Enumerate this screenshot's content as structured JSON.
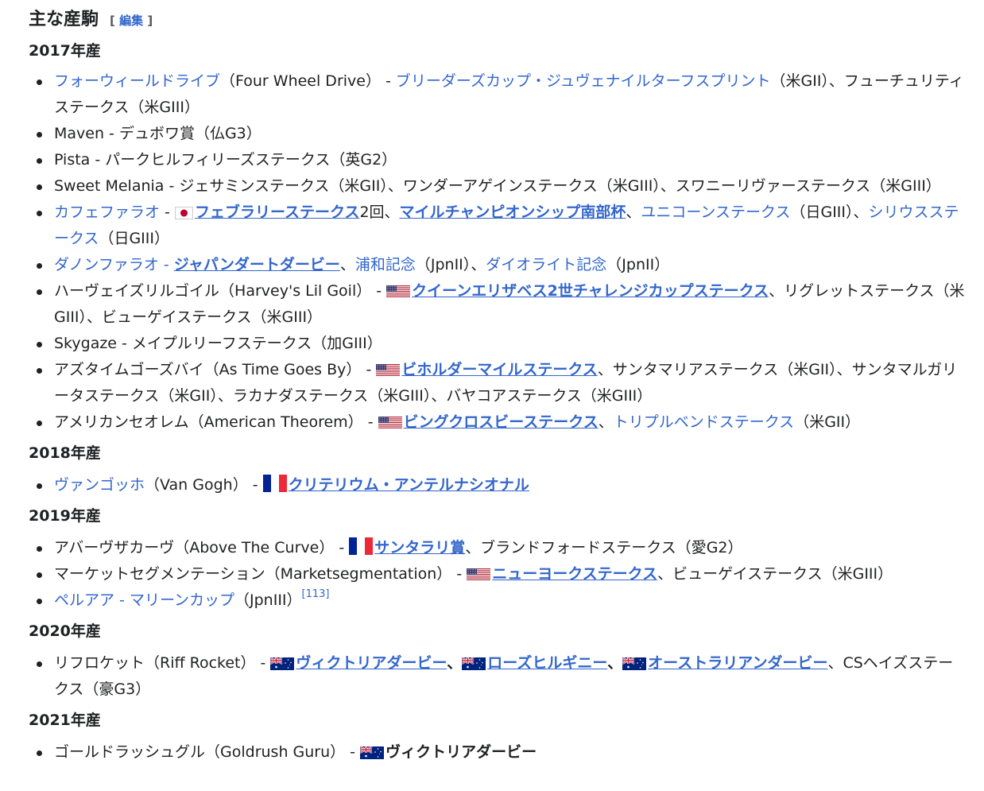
{
  "section": {
    "title": "主な産駒",
    "edit_open": "[ ",
    "edit_label": "編集",
    "edit_close": " ]"
  },
  "years": {
    "y2017": "2017年産",
    "y2018": "2018年産",
    "y2019": "2019年産",
    "y2020": "2020年産",
    "y2021": "2021年産"
  },
  "flags": {
    "jp": "japan-flag-icon",
    "us": "usa-flag-icon",
    "fr": "france-flag-icon",
    "au": "australia-flag-icon"
  },
  "colors": {
    "link": "#3366cc",
    "text": "#202122"
  },
  "items": {
    "i1": {
      "name": "フォーウィールドライブ",
      "orig": "（Four Wheel Drive）",
      "sep": " - ",
      "r1": "ブリーダーズカップ・ジュヴェナイルターフスプリント",
      "rest": "（米GII）、フューチュリティステークス（米GIII）"
    },
    "i2": {
      "text": "Maven - デュボワ賞（仏G3）"
    },
    "i3": {
      "text": "Pista - パークヒルフィリーズステークス（英G2）"
    },
    "i4": {
      "text": "Sweet Melania - ジェサミンステークス（米GII）、ワンダーアゲインステークス（米GIII）、スワニーリヴァーステークス（米GIII）"
    },
    "i5": {
      "name": "カフェファラオ",
      "sep": " - ",
      "r1": "フェブラリーステークス",
      "t1": "2回、",
      "r2": "マイルチャンピオンシップ南部杯",
      "t2": "、",
      "r3": "ユニコーンステークス",
      "t3": "（日GIII）、",
      "r4": "シリウスステークス",
      "t4": "（日GIII）"
    },
    "i6": {
      "name": "ダノンファラオ",
      "sep": " - ",
      "r1": "ジャパンダートダービー",
      "t1": "、",
      "r2": "浦和記念",
      "t2": "（JpnII）、",
      "r3": "ダイオライト記念",
      "t3": "（JpnII）"
    },
    "i7": {
      "name": "ハーヴェイズリルゴイル（Harvey's Lil Goil）",
      "sep": " - ",
      "r1": "クイーンエリザベス2世チャレンジカップステークス",
      "rest": "、リグレットステークス（米GIII）、ビューゲイステークス（米GIII）"
    },
    "i8": {
      "text": "Skygaze - メイプルリーフステークス（加GIII）"
    },
    "i9": {
      "name": "アズタイムゴーズバイ（As Time Goes By）",
      "sep": " - ",
      "r1": "ビホルダーマイルステークス",
      "rest": "、サンタマリアステークス（米GII）、サンタマルガリータステークス（米GII）、ラカナダステークス（米GIII）、バヤコアステークス（米GIII）"
    },
    "i10": {
      "name": "アメリカンセオレム（American Theorem）",
      "sep": " - ",
      "r1": "ビングクロスビーステークス",
      "t1": "、",
      "r2": "トリプルベンドステークス",
      "t2": "（米GII）"
    },
    "i11": {
      "name": "ヴァンゴッホ",
      "orig": "（Van Gogh）",
      "sep": " - ",
      "r1": "クリテリウム・アンテルナシオナル"
    },
    "i12": {
      "name": "アバーヴザカーヴ（Above The Curve）",
      "sep": " - ",
      "r1": "サンタラリ賞",
      "rest": "、ブランドフォードステークス（愛G2）"
    },
    "i13": {
      "name": "マーケットセグメンテーション（Marketsegmentation）",
      "sep": " - ",
      "r1": "ニューヨークステークス",
      "rest": "、ビューゲイステークス（米GIII）"
    },
    "i14": {
      "name": "ペルアア",
      "sep": " - ",
      "r1": "マリーンカップ",
      "rest": "（JpnIII）",
      "ref": "[113]"
    },
    "i15": {
      "name": "リフロケット（Riff Rocket）",
      "sep": " - ",
      "r1": "ヴィクトリアダービー",
      "t1": "、",
      "r2": "ローズヒルギニー",
      "t2": "、",
      "r3": "オーストラリアンダービー",
      "rest": "、CSヘイズステークス（豪G3）"
    },
    "i16": {
      "name": "ゴールドラッシュグル（Goldrush Guru）",
      "sep": " - ",
      "r1": "ヴィクトリアダービー"
    }
  }
}
